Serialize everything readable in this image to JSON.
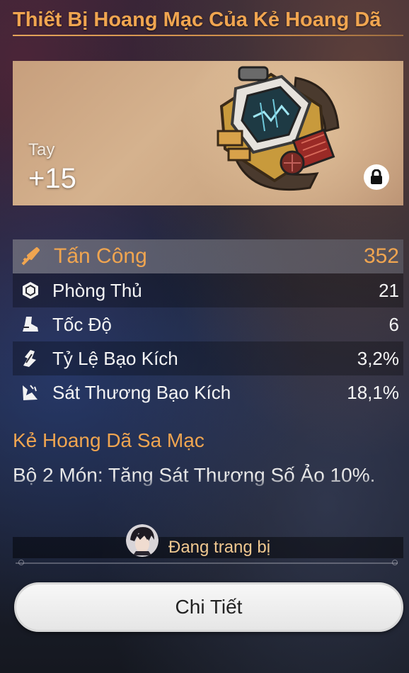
{
  "title": "Thiết Bị Hoang Mạc Của Kẻ Hoang Dã",
  "item": {
    "slot": "Tay",
    "level": "+15",
    "locked": true
  },
  "stats": {
    "main": {
      "label": "Tấn Công",
      "value": "352",
      "icon": "sword-icon"
    },
    "sub": [
      {
        "label": "Phòng Thủ",
        "value": "21",
        "icon": "shield-icon"
      },
      {
        "label": "Tốc Độ",
        "value": "6",
        "icon": "boot-icon"
      },
      {
        "label": "Tỷ Lệ Bạo Kích",
        "value": "3,2%",
        "icon": "crit-rate-icon"
      },
      {
        "label": "Sát Thương Bạo Kích",
        "value": "18,1%",
        "icon": "crit-damage-icon"
      }
    ]
  },
  "set": {
    "name": "Kẻ Hoang Dã Sa Mạc",
    "description": "Bộ 2 Món: Tăng Sát Thương Số Ảo 10%."
  },
  "equip": {
    "status": "Đang trang bị"
  },
  "detail_button": {
    "label": "Chi Tiết"
  },
  "colors": {
    "accent": "#f0a550",
    "button_bg": "#f2f2f2",
    "card_bg": "#d0ab88"
  }
}
